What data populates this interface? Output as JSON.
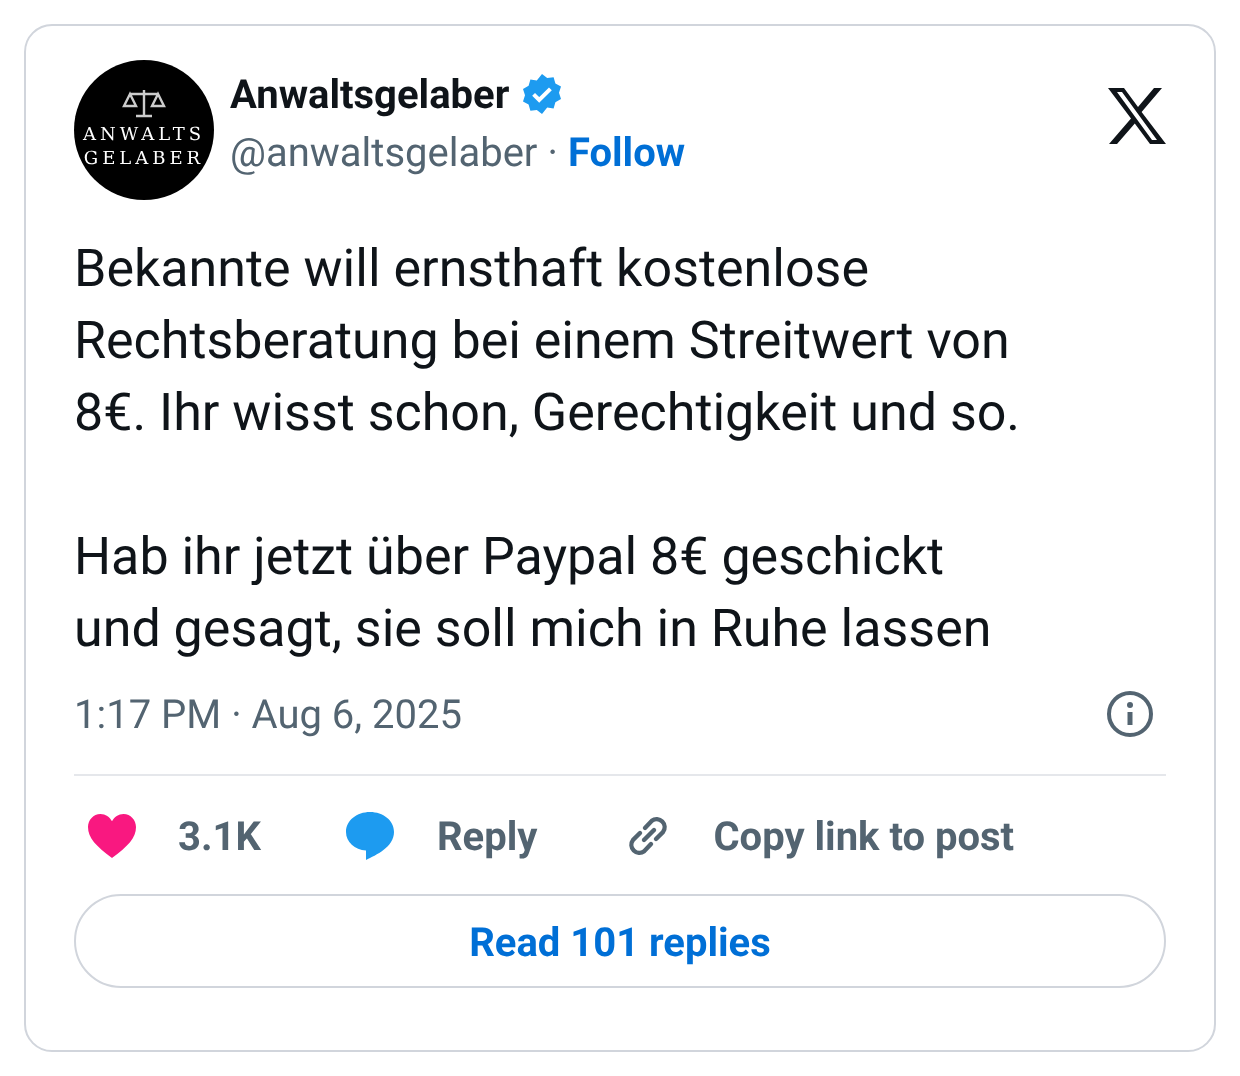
{
  "author": {
    "avatar_text": [
      "ANWALTS",
      "GELABER"
    ],
    "name": "Anwaltsgelaber",
    "verified": true,
    "handle": "@anwaltsgelaber",
    "separator": "·",
    "follow": "Follow"
  },
  "paragraphs": [
    "Bekannte will ernsthaft kostenlose\nRechtsberatung bei einem Streitwert von\n8€. Ihr wisst schon, Gerechtigkeit und so.",
    "Hab ihr jetzt über Paypal 8€ geschickt\nund gesagt, sie soll mich in Ruhe lassen"
  ],
  "timestamp": "1:17 PM · Aug 6, 2025",
  "actions": [
    {
      "kind": "like",
      "label": "3.1K"
    },
    {
      "kind": "reply",
      "label": "Reply"
    },
    {
      "kind": "copy",
      "label": "Copy link to post"
    }
  ],
  "read_button": "Read 101 replies"
}
